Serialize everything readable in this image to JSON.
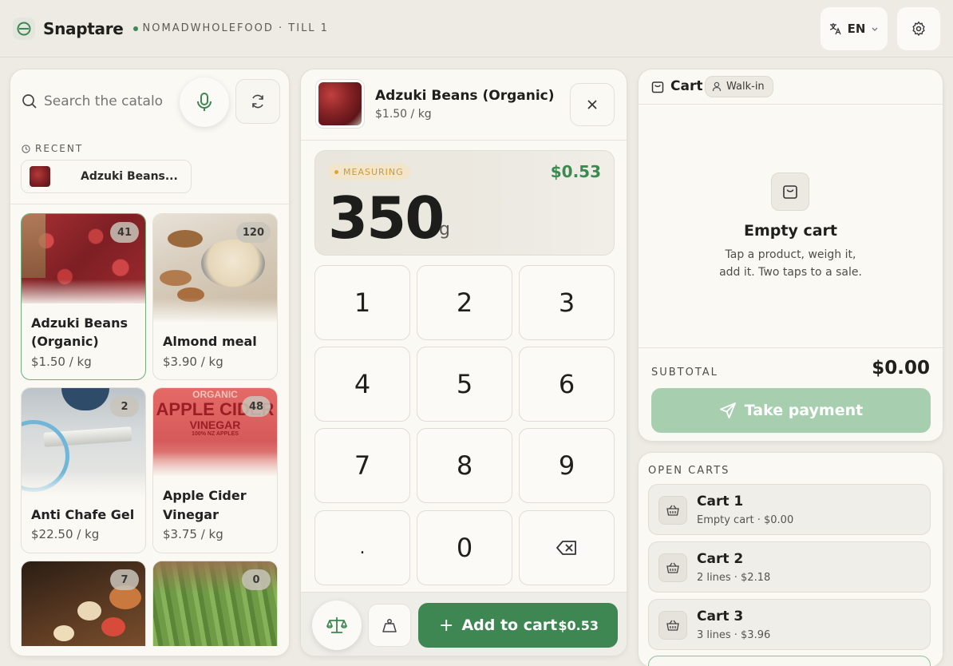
{
  "header": {
    "brand": "Snaptare",
    "store": "NOMADWHOLEFOOD · TILL 1",
    "language": "EN"
  },
  "left": {
    "search_placeholder": "Search the catalog",
    "recent_label": "RECENT",
    "recent_item": "Adzuki Beans...",
    "products": [
      {
        "name_line1": "Adzuki Beans",
        "name_line2": "(Organic)",
        "price": "$1.50 / kg",
        "count": "41"
      },
      {
        "name_line1": "Almond meal",
        "name_line2": "",
        "price": "$3.90 / kg",
        "count": "120"
      },
      {
        "name_line1": "Anti Chafe Gel",
        "name_line2": "",
        "price": "$22.50 / kg",
        "count": "2"
      },
      {
        "name_line1": "Apple Cider",
        "name_line2": "Vinegar",
        "price": "$3.75 / kg",
        "count": "48"
      },
      {
        "name_line1": "",
        "name_line2": "",
        "price": "",
        "count": "7"
      },
      {
        "name_line1": "",
        "name_line2": "",
        "price": "",
        "count": "0"
      }
    ],
    "apple_cider_label": {
      "top": "ORGANIC",
      "mid": "APPLE CIDER",
      "bottom": "VINEGAR",
      "small": "100% NZ APPLES"
    }
  },
  "middle": {
    "product_name": "Adzuki Beans (Organic)",
    "product_price": "$1.50 / kg",
    "status": "MEASURING",
    "weight_price": "$0.53",
    "weight": "350",
    "unit": "g",
    "keys": [
      "1",
      "2",
      "3",
      "4",
      "5",
      "6",
      "7",
      "8",
      "9",
      ".",
      "0"
    ],
    "add_label": "Add to cart",
    "add_amount": "$0.53"
  },
  "cart": {
    "title": "Cart",
    "customer": "Walk-in",
    "empty_title": "Empty cart",
    "empty_line1": "Tap a product, weigh it,",
    "empty_line2": "add it. Two taps to a sale.",
    "subtotal_label": "SUBTOTAL",
    "subtotal": "$0.00",
    "pay_label": "Take payment"
  },
  "open_carts": {
    "label": "OPEN CARTS",
    "items": [
      {
        "name": "Cart 1",
        "detail": "Empty cart · $0.00"
      },
      {
        "name": "Cart 2",
        "detail": "2 lines · $2.18"
      },
      {
        "name": "Cart 3",
        "detail": "3 lines · $3.96"
      }
    ]
  },
  "colors": {
    "accent": "#3e8652",
    "accent_light": "#a8ceb0",
    "measuring": "#e0a530"
  }
}
